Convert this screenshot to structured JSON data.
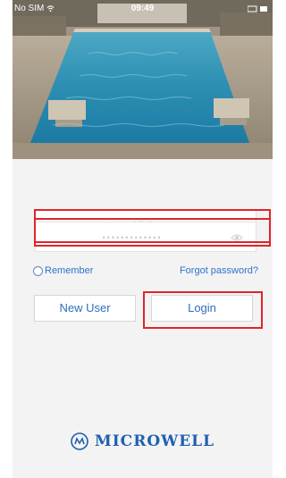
{
  "status_bar": {
    "carrier": "No SIM",
    "time": "09:49"
  },
  "login_form": {
    "email_value": "g.harrison87@yahoo.com",
    "password_masked": "•••••••••••••",
    "remember_label": "Remember",
    "forgot_label": "Forgot password?",
    "new_user_label": "New User",
    "login_label": "Login"
  },
  "brand": {
    "logo_text": "MICROWELL",
    "logo_mark": "MW"
  },
  "colors": {
    "link_blue": "#2f73c6",
    "brand_blue": "#1f5fb0",
    "highlight_red": "#e0242b"
  },
  "icons": [
    "wifi-icon",
    "eye-icon",
    "radio-button",
    "microwell-logo-mark"
  ]
}
